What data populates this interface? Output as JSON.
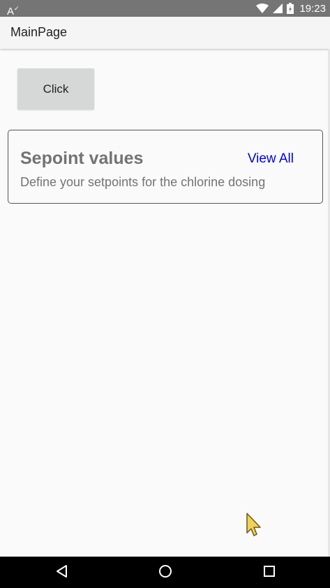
{
  "status_bar": {
    "left_indicator": "A",
    "left_indicator_sup": "✓",
    "time": "19:23",
    "icons": [
      "wifi-icon",
      "signal-icon",
      "battery-icon"
    ]
  },
  "app_bar": {
    "title": "MainPage"
  },
  "main": {
    "click_button_label": "Click",
    "card": {
      "title": "Sepoint values",
      "link_label": "View All",
      "description": "Define your setpoints for the chlorine dosing"
    }
  },
  "nav_bar": {
    "icons": [
      "back-icon",
      "home-icon",
      "recents-icon"
    ]
  },
  "colors": {
    "status_bar": "#757575",
    "app_bar": "#f5f5f5",
    "background": "#fafafa",
    "button": "#d6d7d7",
    "card_text": "#737373",
    "link": "#0000e6",
    "nav_bar": "#000000"
  }
}
